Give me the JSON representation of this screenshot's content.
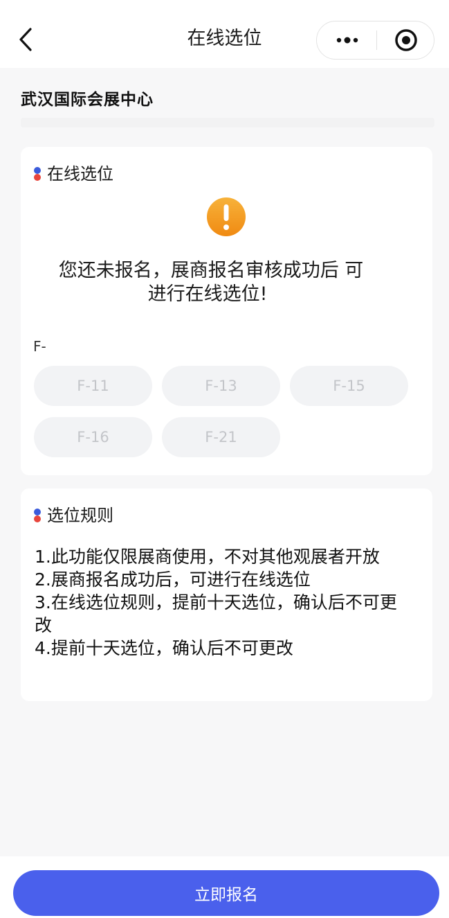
{
  "header": {
    "title": "在线选位",
    "back_icon": "chevron-left-icon",
    "more_icon": "more-dots-icon",
    "close_icon": "target-circle-icon"
  },
  "venue": {
    "name": "武汉国际会展中心"
  },
  "selection_card": {
    "section_title": "在线选位",
    "warning_icon": "exclamation-warning-icon",
    "message_line1": "您还未报名，展商报名审核成功后 可",
    "message_line2": "进行在线选位!",
    "zone_label": "F-",
    "booths": [
      "F-11",
      "F-13",
      "F-15",
      "F-16",
      "F-21"
    ]
  },
  "rules_card": {
    "section_title": "选位规则",
    "rules": [
      "1.此功能仅限展商使用，不对其他观展者开放",
      "2.展商报名成功后，可进行在线选位",
      "3.在线选位规则，提前十天选位，确认后不可更改",
      "4.提前十天选位，确认后不可更改"
    ]
  },
  "footer": {
    "signup_label": "立即报名"
  },
  "colors": {
    "primary": "#4a60ec",
    "warning_orange": "#f39a1e",
    "booth_bg": "#f2f3f5",
    "booth_text": "#c3c5c9",
    "dot_blue": "#3b5bdb",
    "dot_red": "#e8453c"
  }
}
